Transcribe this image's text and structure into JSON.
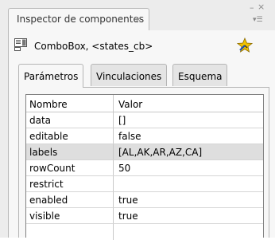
{
  "panel": {
    "tab_label": "Inspector de componentes",
    "close_glyph": "×",
    "minimize_glyph": "–",
    "window_close_glyph": "×",
    "menu_glyph": "▾☰"
  },
  "component": {
    "title": "ComboBox, <states_cb>",
    "icon": "combobox-icon",
    "badge_icon": "live-preview-icon"
  },
  "tabs": [
    {
      "label": "Parámetros",
      "active": true
    },
    {
      "label": "Vinculaciones",
      "active": false
    },
    {
      "label": "Esquema",
      "active": false
    }
  ],
  "grid": {
    "headers": {
      "name": "Nombre",
      "value": "Valor"
    },
    "rows": [
      {
        "name": "data",
        "value": "[]"
      },
      {
        "name": "editable",
        "value": "false"
      },
      {
        "name": "labels",
        "value": "[AL,AK,AR,AZ,CA]"
      },
      {
        "name": "rowCount",
        "value": "50"
      },
      {
        "name": "restrict",
        "value": ""
      },
      {
        "name": "enabled",
        "value": "true"
      },
      {
        "name": "visible",
        "value": "true"
      }
    ],
    "selected_index": 2
  }
}
